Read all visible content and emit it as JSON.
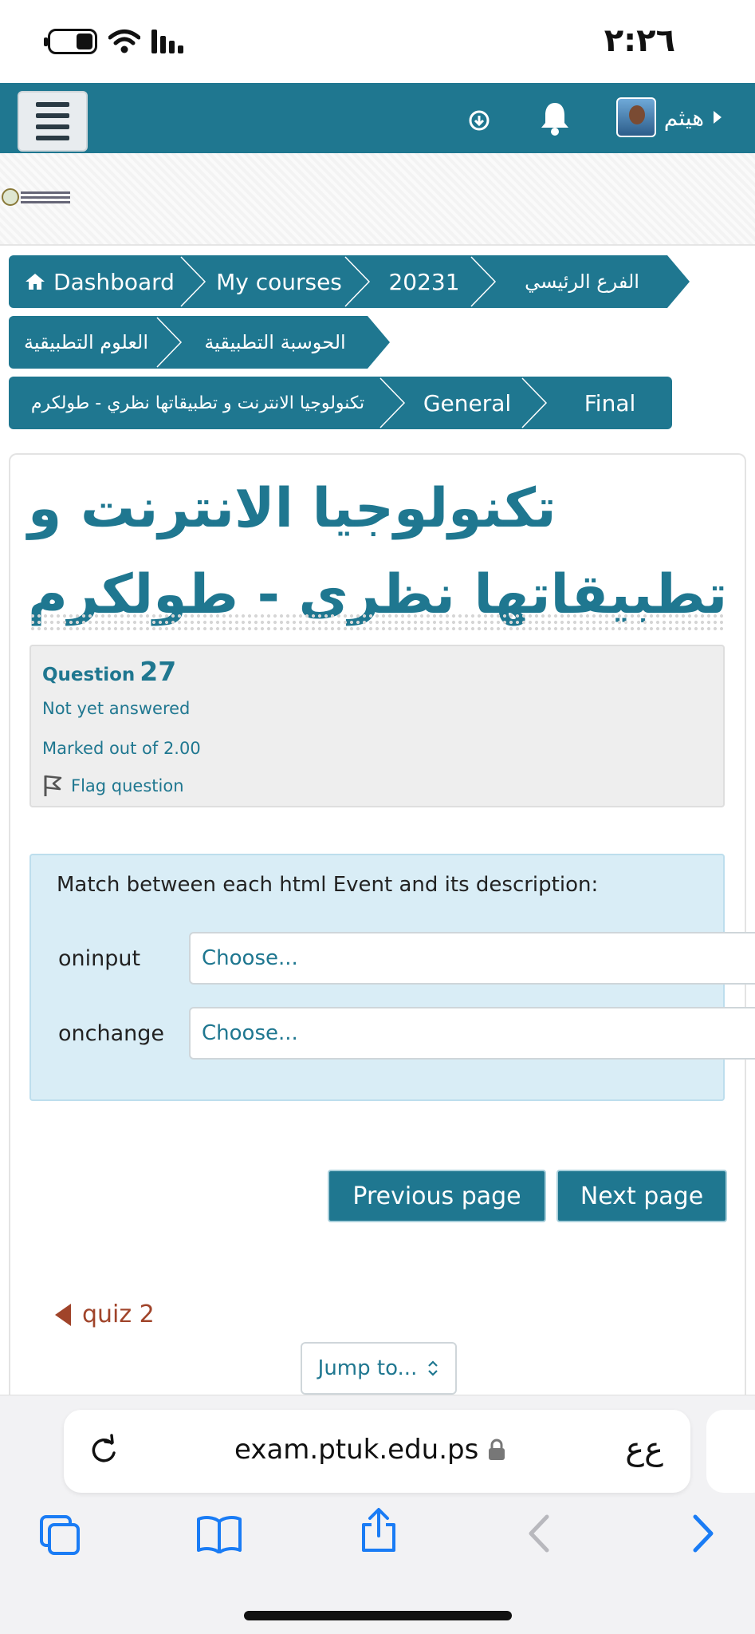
{
  "status_bar": {
    "time": "٢:٢٦"
  },
  "navbar": {
    "user_name": "هيثم"
  },
  "breadcrumb": {
    "items": [
      "Dashboard",
      "My courses",
      "20231",
      "الفرع الرئيسي",
      "الحوسبة التطبيقية",
      "العلوم التطبيقية",
      "تكنولوجيا الانترنت و تطبيقاتها نظري - طولكرم",
      "General",
      "Final"
    ]
  },
  "course": {
    "title": "تكنولوجيا الانترنت و تطبيقاتها نظرى - طولكرم"
  },
  "question_info": {
    "label": "Question",
    "number": "27",
    "state": "Not yet answered",
    "marks": "Marked out of 2.00",
    "flag": "Flag question"
  },
  "question": {
    "text": "Match between each html Event and its description:",
    "rows": [
      {
        "label": "oninput",
        "select_value": "Choose..."
      },
      {
        "label": "onchange",
        "select_value": "Choose..."
      }
    ]
  },
  "nav_buttons": {
    "previous": "Previous page",
    "next": "Next page"
  },
  "activity_nav": {
    "prev_link": "quiz 2",
    "jump_to": "Jump to..."
  },
  "browser": {
    "url": "exam.ptuk.edu.ps",
    "aa": "ع‌ع"
  },
  "colors": {
    "primary": "#1f7790",
    "question_bg": "#d9edf6",
    "info_bg": "#eeeeee",
    "link_red": "#a0442a",
    "ios_blue": "#1a7cf5"
  }
}
